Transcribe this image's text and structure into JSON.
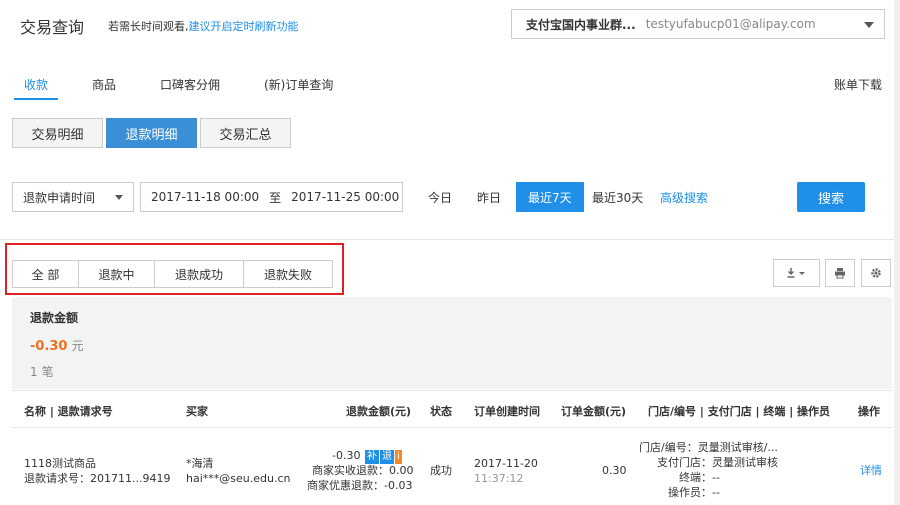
{
  "header": {
    "title": "交易查询",
    "hint_text": "若需长时间观看,",
    "hint_link": "建议开启定时刷新功能",
    "account_name": "支付宝国内事业群...",
    "account_email": "testyufabucp01@alipay.com"
  },
  "nav": {
    "tabs": [
      {
        "label": "收款",
        "active": true
      },
      {
        "label": "商品"
      },
      {
        "label": "口碑客分佣"
      },
      {
        "label": "(新)订单查询"
      }
    ],
    "bill_download": "账单下载"
  },
  "subtabs": [
    {
      "label": "交易明细"
    },
    {
      "label": "退款明细",
      "active": true
    },
    {
      "label": "交易汇总"
    }
  ],
  "filter": {
    "time_type": "退款申请时间",
    "start": "2017-11-18 00:00",
    "to": "至",
    "end": "2017-11-25 00:00",
    "today": "今日",
    "yesterday": "昨日",
    "last7": "最近7天",
    "last30": "最近30天",
    "advanced": "高级搜索",
    "search": "搜索"
  },
  "status_filter": [
    "全 部",
    "退款中",
    "退款成功",
    "退款失败"
  ],
  "summary": {
    "label": "退款金额",
    "amount": "-0.30",
    "unit": "元",
    "count": "1 笔"
  },
  "table": {
    "headers": [
      "名称 | 退款请求号",
      "买家",
      "退款金额(元)",
      "状态",
      "订单创建时间",
      "订单金额(元)",
      "门店/编号 | 支付门店 | 终端 | 操作员",
      "操作"
    ],
    "row": {
      "name": "1118测试商品",
      "refund_no": "退款请求号：201711...9419",
      "buyer_name": "*海清",
      "buyer_email": "hai***@seu.edu.cn",
      "refund_amount": "-0.30",
      "tag1": "补",
      "tag2": "退",
      "tag3": "i",
      "merchant_refund": "商家实收退款：0.00",
      "merchant_discount": "商家优惠退款：-0.03",
      "status": "成功",
      "order_date": "2017-11-20",
      "order_time": "11:37:12",
      "order_amount": "0.30",
      "store": "门店/编号：灵量测试审核/...",
      "pay_store": "支付门店：灵量测试审核",
      "terminal": "终端：--",
      "operator": "操作员：--",
      "action": "详情"
    }
  }
}
